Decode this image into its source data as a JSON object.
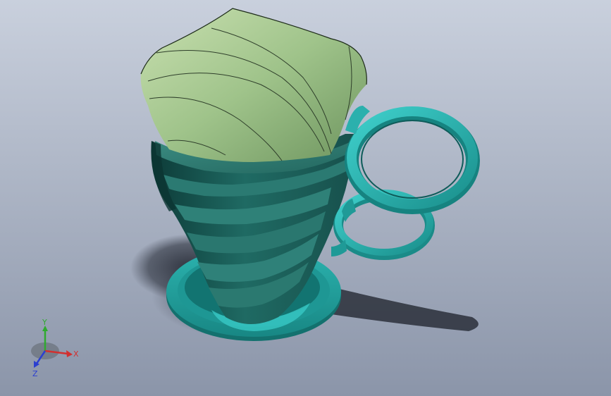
{
  "viewport": {
    "background_top": "#c9d0dd",
    "background_bottom": "#8a95aa"
  },
  "model": {
    "name": "twisted-mug",
    "inner_color": "#9ec48a",
    "outer_color_light": "#2f7f76",
    "outer_color_dark": "#0f3f3c",
    "handle_color": "#2bb0ad",
    "base_color": "#2aa7a4"
  },
  "triad": {
    "x_label": "X",
    "y_label": "Y",
    "z_label": "Z",
    "x_color": "#d23030",
    "y_color": "#2faa2f",
    "z_color": "#2b3fd0"
  }
}
